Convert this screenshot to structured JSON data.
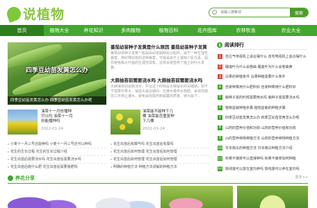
{
  "header": {
    "logo_text": "说植物",
    "search_placeholder": "请输入搜索词",
    "search_button": "搜索"
  },
  "nav": [
    "首页",
    "植物大全",
    "养花知识",
    "多肉植物",
    "植物百科",
    "花卉图库",
    "农林牧渔",
    "农业大全"
  ],
  "feature": {
    "overlay_text": "四季豆幼苗发黄怎么办",
    "caption": "四季豆幼苗发黄怎么办 四季豆幼苗发黄怎么办呢"
  },
  "articles": [
    {
      "title": "番茄幼苗种子发黄是什么原因 番茄幼苗种子发黄",
      "desc": "番茄幼苗种子发黄一般是由幼苗期缺氮引起的，属于一种生理性病害，西红柿幼苗的这种病害，可能是由于土壤缺少氮元素，因而使植株大叶面的生理性现象，这样会使营养了植土的叶片发黄，"
    },
    {
      "title": "大蒜抽苔前需要浇水吗 大蒜抽苔前需要浇水吗",
      "desc": "大蒜抽苔前需要浇水，并且这个时候是大蒜需水的关键期，如于干需要补果大，抽苔大蒜这期间，应遵水量供水施肥。采收前做前三天停止灌水，避免采收损伤到蒜薹的质量，使大蒜下..."
    }
  ],
  "mini_cards": [
    {
      "title": "油菜十一月份播种可以吗 油菜十一月份能播种吗",
      "date": "2022-01-24"
    },
    {
      "title": "油菜能不能种下几棵 油菜能否重复种下几棵",
      "date": "2022-01-24"
    }
  ],
  "links_left": [
    "小麦十一月三号还能种吗 小麦十一月三号还可以种吗",
    "花生的生长过程 花生的生长过程介绍",
    "花生出苗后需要浇水吗 花生出苗后需要浇水吗",
    "花生出苗后施什么肥 花生出苗后需要施肥吗",
    "花生出苗后需要浇水吗 花生出苗后需浇水吗"
  ],
  "links_right": [
    "花生出苗后有脚气吗 花生出苗后有蘖吗",
    "花生出苗后如何管理 花生出苗后如何管理",
    "花生出苗后如何管理 花生出苗后如何管理",
    "明确的种植方法 种植方法讲解的种植方法"
  ],
  "ranking": {
    "title": "阅读排行",
    "color_top": "#e04a3a",
    "color_rest": "#43a82f",
    "items": [
      "自古气电视机上适合摆什么 自宅电视机上适合摆什么",
      "睡莲叶为什么会卷曲 睡莲叶为什么会卷曲黄",
      "白果的种植条件 白果种植需要什么条件",
      "自家种菜用什么肥料好 自家种菜用什么肥料好",
      "栽种子苗的时候需要用水吗 栽种子苗需要浇水吗",
      "植物盆栽种植步骤 植物盆栽的种植步骤",
      "四季豆幼苗发黄怎么办 四季豆幼苗发黄怎么办呢",
      "山药的营养价值和功效 山药的营养价值和功效",
      "山的营养秧杨种植方法 山药的营养秧杨种植方法",
      "日本南瓜的种植方法 日本南瓜种植方法介绍",
      "秋菜不播芽可以直接种吗 秋菜不播芽如何种植",
      "铁线莲可以放在室内养吗 铁线莲可以养在室内吗"
    ]
  },
  "share": {
    "title": "养花分享",
    "more": "更多>>"
  }
}
